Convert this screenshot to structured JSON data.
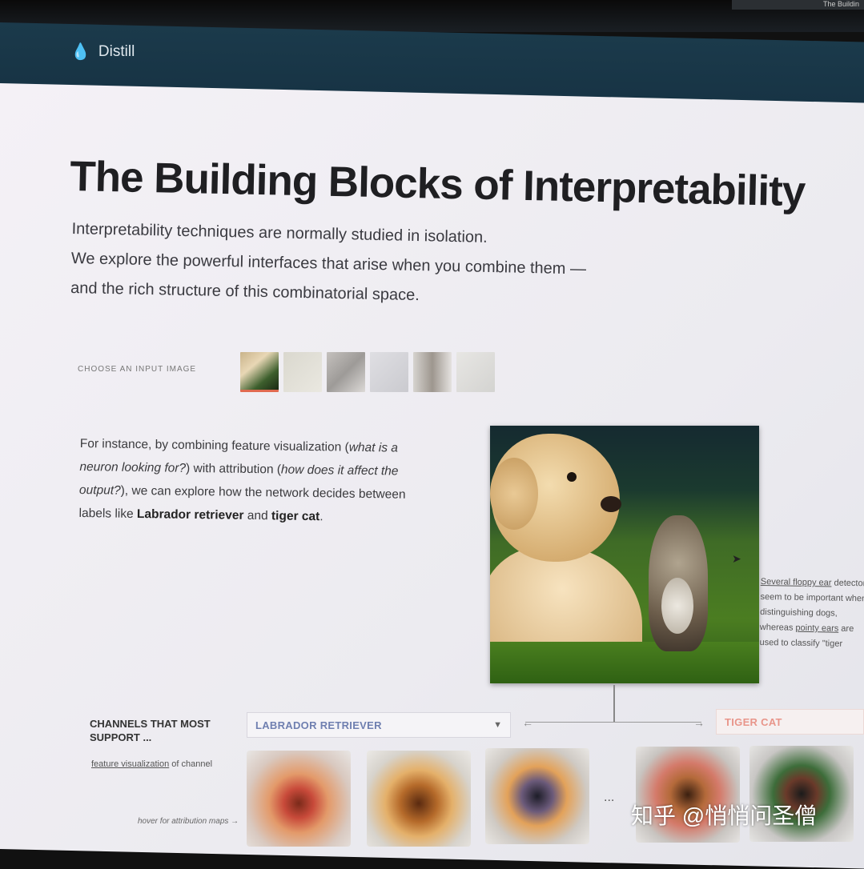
{
  "browser": {
    "tab_title": "The Buildin"
  },
  "nav": {
    "logo_icon": "droplet-icon",
    "logo_text": "Distill"
  },
  "article": {
    "title": "The Building Blocks of Interpretability",
    "subtitle_lines": [
      "Interpretability techniques are normally studied in isolation.",
      "We explore the powerful interfaces that arise when you combine them —",
      "and the rich structure of this combinatorial space."
    ]
  },
  "input_picker": {
    "label": "CHOOSE AN INPUT IMAGE",
    "thumbnail_count": 6,
    "selected_index": 0
  },
  "intro": {
    "p1": "For instance, by combining feature visualization (",
    "q1": "what is a neuron looking for?",
    "p2": ") with attribution (",
    "q2": "how does it affect the output?",
    "p3": "), we can explore how the network decides between labels like ",
    "label1": "Labrador retriever",
    "p4": " and ",
    "label2": "tiger cat",
    "p5": "."
  },
  "side_note": {
    "link1": "Several floppy ear",
    "t1": " detectors seem to be important when distinguishing dogs, whereas ",
    "link2": "pointy ears",
    "t2": " are used to classify \"tiger"
  },
  "channels": {
    "heading": "CHANNELS THAT MOST SUPPORT ...",
    "fv_link": "feature visualization",
    "fv_suffix": " of channel",
    "hover_hint": "hover for attribution maps →",
    "labrador_select": "LABRADOR RETRIEVER",
    "tiger_label": "TIGER CAT",
    "ellipsis": "...",
    "colors": {
      "labrador": "#6f7fb0",
      "tiger": "#e8958a"
    }
  },
  "watermark": {
    "text": "知乎 @悄悄问圣僧"
  }
}
